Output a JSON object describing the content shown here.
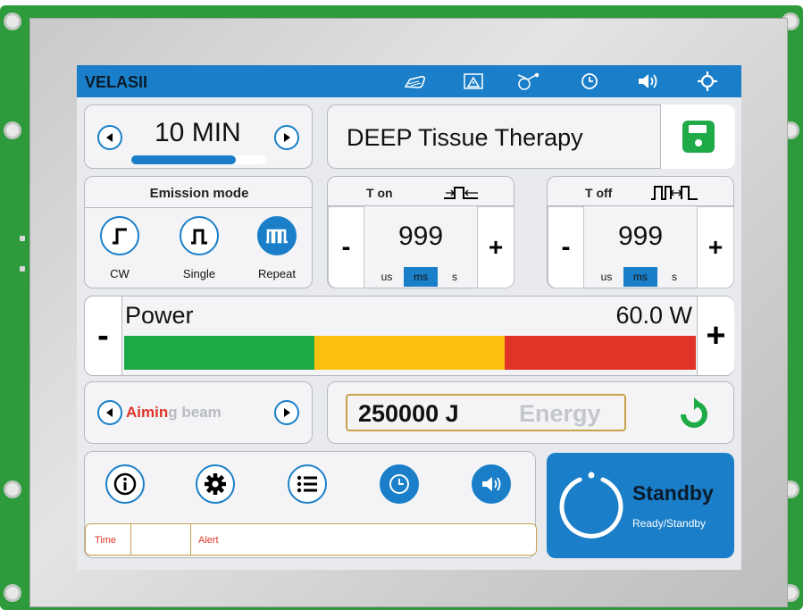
{
  "header": {
    "brand": "VELASII"
  },
  "timer": {
    "value": "10 MIN",
    "progress": 0.77
  },
  "program": {
    "name": "DEEP Tissue Therapy"
  },
  "emission": {
    "title": "Emission mode",
    "modes": [
      {
        "label": "CW",
        "selected": false
      },
      {
        "label": "Single",
        "selected": false
      },
      {
        "label": "Repeat",
        "selected": true
      }
    ]
  },
  "ton": {
    "title": "T on",
    "value": "999",
    "units": [
      "us",
      "ms",
      "s"
    ],
    "active_unit": "ms",
    "minus": "-",
    "plus": "+"
  },
  "toff": {
    "title": "T off",
    "value": "999",
    "units": [
      "us",
      "ms",
      "s"
    ],
    "active_unit": "ms",
    "minus": "-",
    "plus": "+"
  },
  "power": {
    "label": "Power",
    "value": "60.0 W",
    "minus": "-",
    "plus": "+",
    "zones": [
      {
        "color": "#1daa47",
        "fraction": 0.333
      },
      {
        "color": "#fcc10f",
        "fraction": 0.333
      },
      {
        "color": "#e03428",
        "fraction": 0.334
      }
    ]
  },
  "aiming": {
    "label_red": "Aimin",
    "label_grey": "g beam"
  },
  "energy": {
    "value": "250000 J",
    "label": "Energy"
  },
  "status": {
    "title": "Standby",
    "subtitle": "Ready/Standby"
  },
  "alertbar": {
    "time_label": "Time",
    "alert_label": "Alert"
  },
  "colors": {
    "accent": "#1a7fc8",
    "alert_text": "#e03428",
    "energy_border": "#c8a24a",
    "refresh": "#1daa47"
  },
  "icons": {
    "header": [
      "handpiece-icon",
      "screen-target-icon",
      "fiber-icon",
      "clock-icon",
      "speaker-icon",
      "crosshair-icon"
    ],
    "bottom": [
      "info-icon",
      "gear-icon",
      "list-icon",
      "clock-icon",
      "speaker-icon"
    ]
  }
}
